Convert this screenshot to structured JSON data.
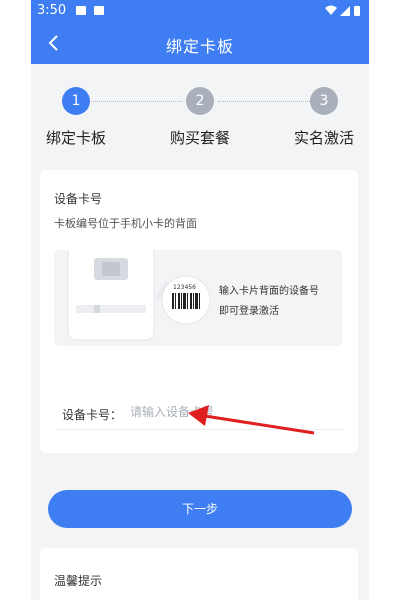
{
  "status_bar": {
    "time": "3:50"
  },
  "nav": {
    "title": "绑定卡板"
  },
  "steps": [
    {
      "number": "1",
      "label": "绑定卡板",
      "active": true
    },
    {
      "number": "2",
      "label": "购买套餐",
      "active": false
    },
    {
      "number": "3",
      "label": "实名激活",
      "active": false
    }
  ],
  "card": {
    "title": "设备卡号",
    "subtitle": "卡板编号位于手机小卡的背面",
    "illustration": {
      "barcode_number": "123456",
      "line1": "输入卡片背面的设备号",
      "line2": "即可登录激活"
    },
    "field_label": "设备卡号：",
    "field_placeholder": "请输入设备卡号",
    "field_value": ""
  },
  "next_button": "下一步",
  "tips_title": "温馨提示",
  "colors": {
    "primary": "#3f7ef2",
    "step_inactive": "#a9b0bc",
    "background": "#f3f4f6",
    "annotation_arrow": "#e02020"
  }
}
